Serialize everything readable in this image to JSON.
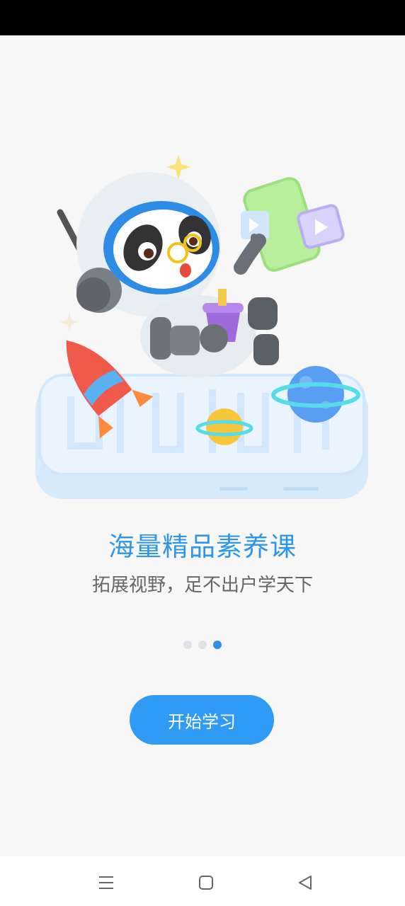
{
  "onboarding": {
    "title": "海量精品素养课",
    "subtitle": "拓展视野，足不出户学天下",
    "start_button": "开始学习",
    "page_indicator": {
      "total": 3,
      "current": 3
    }
  },
  "nav_bar": {
    "icons": [
      "menu-icon",
      "home-square-icon",
      "back-triangle-icon"
    ]
  },
  "colors": {
    "accent": "#2f95e8",
    "button": "#2f9bf5",
    "background": "#f7f7f7"
  }
}
